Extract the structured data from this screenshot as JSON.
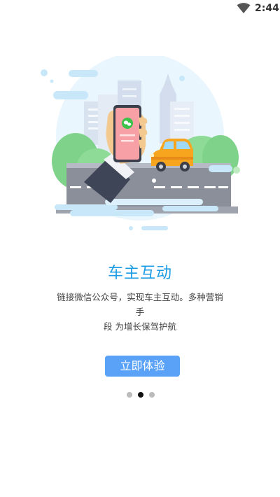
{
  "status_bar": {
    "time": "2:44",
    "wifi_icon": "wifi-icon"
  },
  "onboarding": {
    "title": "车主互动",
    "description_line1": "链接微信公众号，实现车主互动。多种营销手",
    "description_line2": "段 为增长保驾护航",
    "cta_label": "立即体验",
    "page_indicator": {
      "total": 3,
      "current": 2
    }
  },
  "colors": {
    "accent": "#1a9be6",
    "button": "#5aa2f8",
    "dot_active": "#111111",
    "dot_inactive": "#bbbbbb"
  }
}
